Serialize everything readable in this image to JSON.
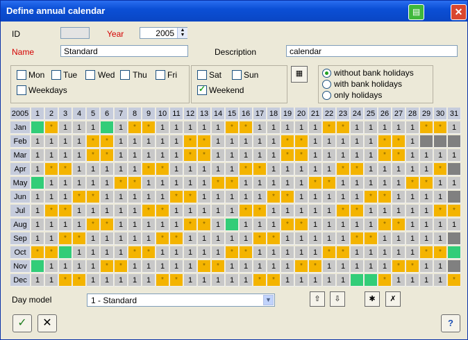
{
  "window": {
    "title": "Define annual calendar"
  },
  "form": {
    "id_label": "ID",
    "id_value": "",
    "year_label": "Year",
    "year_value": "2005",
    "name_label": "Name",
    "name_value": "Standard",
    "description_label": "Description",
    "description_value": "calendar"
  },
  "weekdays": {
    "mon": "Mon",
    "tue": "Tue",
    "wed": "Wed",
    "thu": "Thu",
    "fri": "Fri",
    "weekdays": "Weekdays"
  },
  "weekend": {
    "sat": "Sat",
    "sun": "Sun",
    "weekend": "Weekend",
    "weekend_checked": true
  },
  "holidays": {
    "options": [
      "without bank holidays",
      "with bank holidays",
      "only holidays"
    ],
    "selected": 0
  },
  "calendar": {
    "year": "2005",
    "day_headers": [
      "1",
      "2",
      "3",
      "4",
      "5",
      "6",
      "7",
      "8",
      "9",
      "10",
      "11",
      "12",
      "13",
      "14",
      "15",
      "16",
      "17",
      "18",
      "19",
      "20",
      "21",
      "22",
      "23",
      "24",
      "25",
      "26",
      "27",
      "28",
      "29",
      "30",
      "31"
    ],
    "months": [
      "Jan",
      "Feb",
      "Mar",
      "Apr",
      "May",
      "Jun",
      "Jul",
      "Aug",
      "Sep",
      "Oct",
      "Nov",
      "Dec"
    ],
    "workday_value": "1",
    "weekend_value": "*",
    "day_codes": [
      "GW111G1WW11111WW11111WW11111WW1",
      "1111WW11111WW11111WW11111WW1XXX",
      "1111WW11111WW11111WW11111WW1111",
      "1WW11111WW11111WW11111WW11111WX",
      "G11111WW11111WW11111WW11111WW11",
      "111WW11111WW11111WW11111WW1111X",
      "1WW11111WW11111WW11111WW11111WW",
      "1111WW11111WW1G111WW11111WW1111",
      "11WW11111WW11111WW11111WW11111X",
      "WWG1111WW11111WW11111WW11111WWG",
      "G1111WW11111WW11111WW11111WW11X",
      "11WW11111WW11111WW11111GGW1111W"
    ]
  },
  "footer": {
    "day_model_label": "Day model",
    "day_model_value": "1 - Standard"
  },
  "colors": {
    "workday": "#c8c8c8",
    "weekend": "#f4b400",
    "holiday": "#32cd78",
    "invalid": "#808080",
    "header": "#c6ccdc"
  }
}
